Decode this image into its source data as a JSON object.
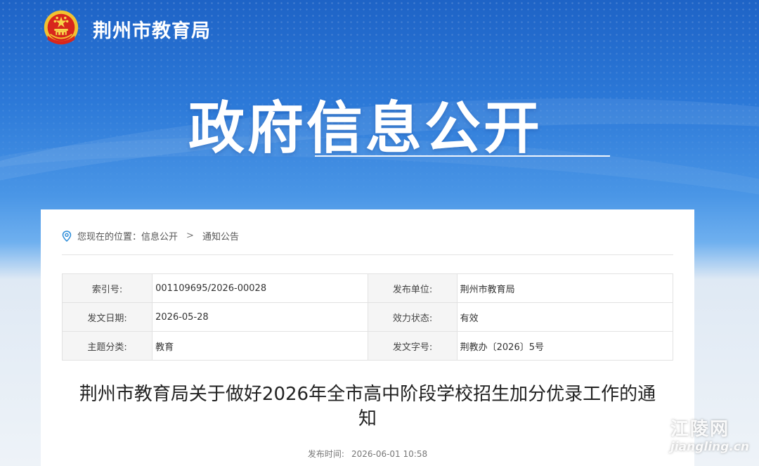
{
  "header": {
    "site_name": "荆州市教育局",
    "emblem_icon": "national-emblem-icon"
  },
  "hero": {
    "title": "政府信息公开"
  },
  "breadcrumb": {
    "icon": "location-pin-icon",
    "prefix": "您现在的位置：",
    "level1": "信息公开",
    "separator": ">",
    "level2": "通知公告"
  },
  "meta_table": {
    "rows": [
      {
        "label_left": "索引号:",
        "value_left": "001109695/2026-00028",
        "label_right": "发布单位:",
        "value_right": "荆州市教育局"
      },
      {
        "label_left": "发文日期:",
        "value_left": "2026-05-28",
        "label_right": "效力状态:",
        "value_right": "有效"
      },
      {
        "label_left": "主题分类:",
        "value_left": "教育",
        "label_right": "发文字号:",
        "value_right": "荆教办〔2026〕5号"
      }
    ]
  },
  "document": {
    "title_line1": "荆州市教育局关于做好2026年全市高中阶段学校招生加分优录工作的通",
    "title_line2": "知",
    "publish_label": "发布时间:",
    "publish_time": "2026-06-01 10:58"
  },
  "watermark": {
    "cn": "江陵网",
    "en": "jiangling.cn"
  },
  "colors": {
    "brand_blue": "#2c79d8",
    "card_bg": "#ffffff",
    "label_bg": "#f5f5f5",
    "pin_blue": "#2a8bd8"
  }
}
